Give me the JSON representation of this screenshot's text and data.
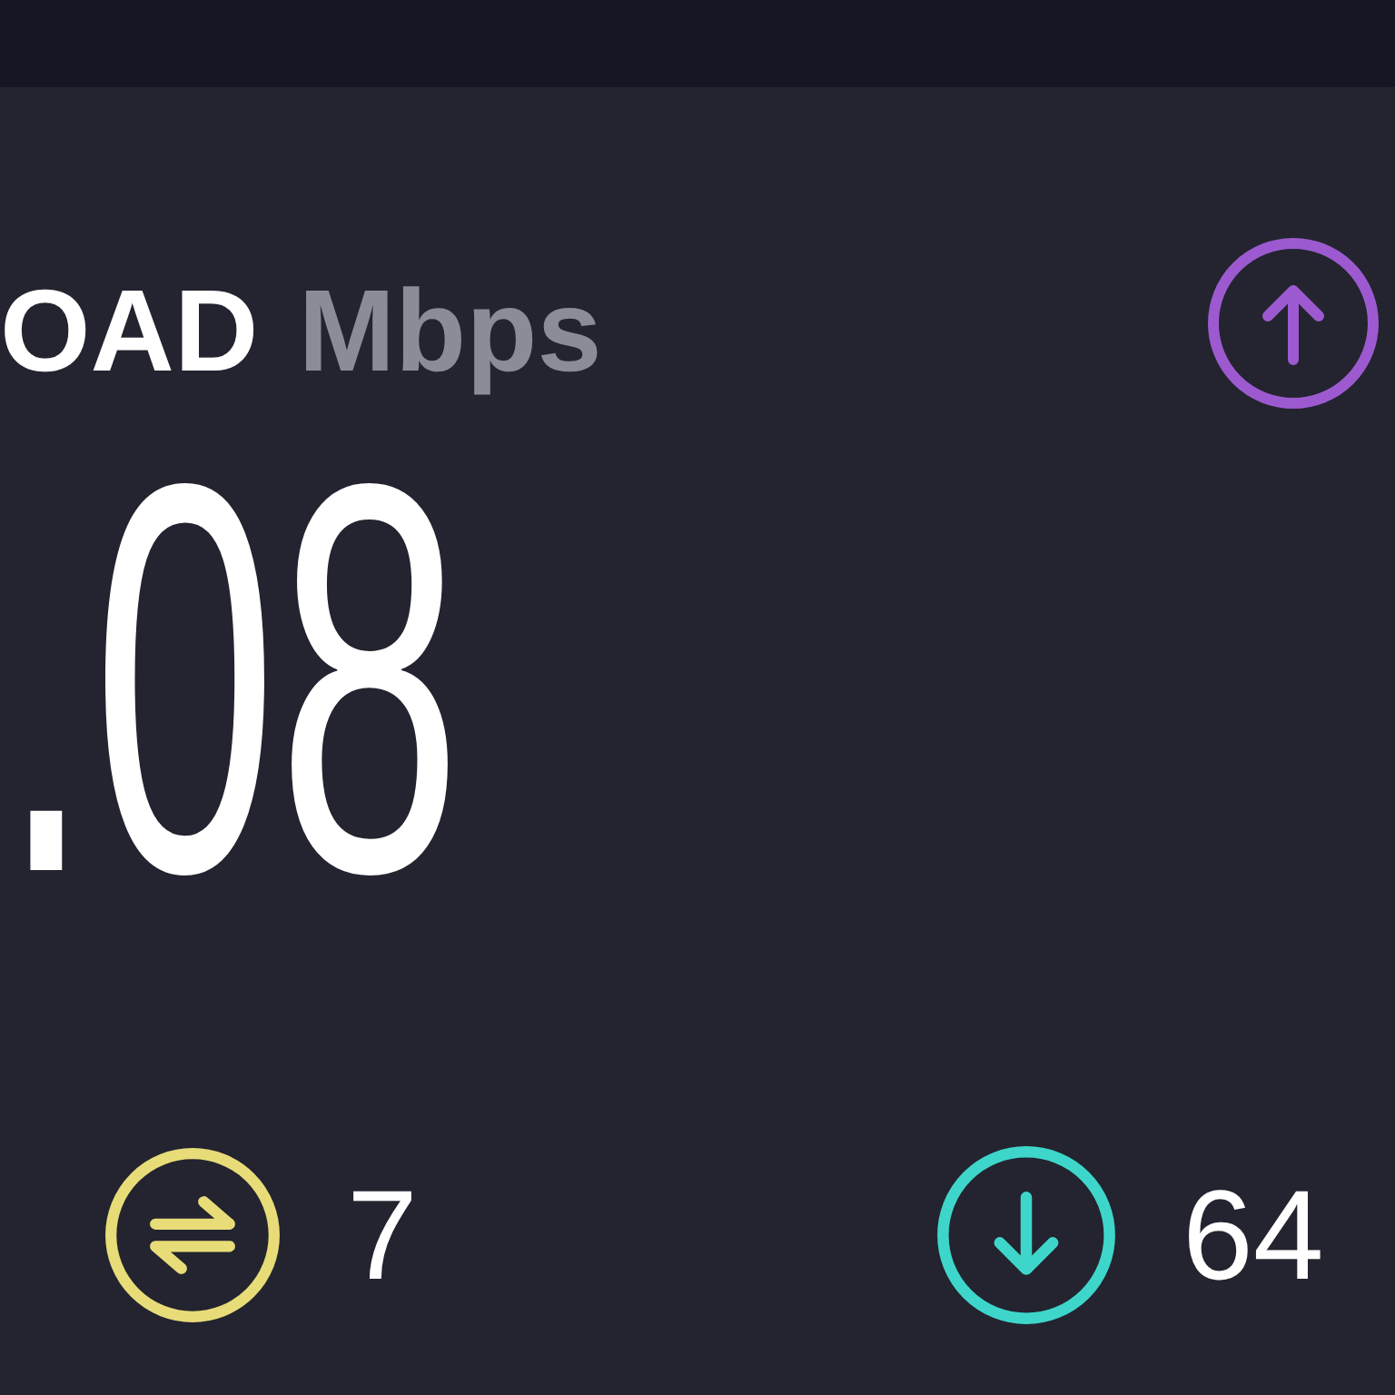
{
  "upload": {
    "label": "OAD",
    "unit": "Mbps",
    "value": ".08"
  },
  "ping": {
    "value": "7"
  },
  "download": {
    "value": "64"
  }
}
